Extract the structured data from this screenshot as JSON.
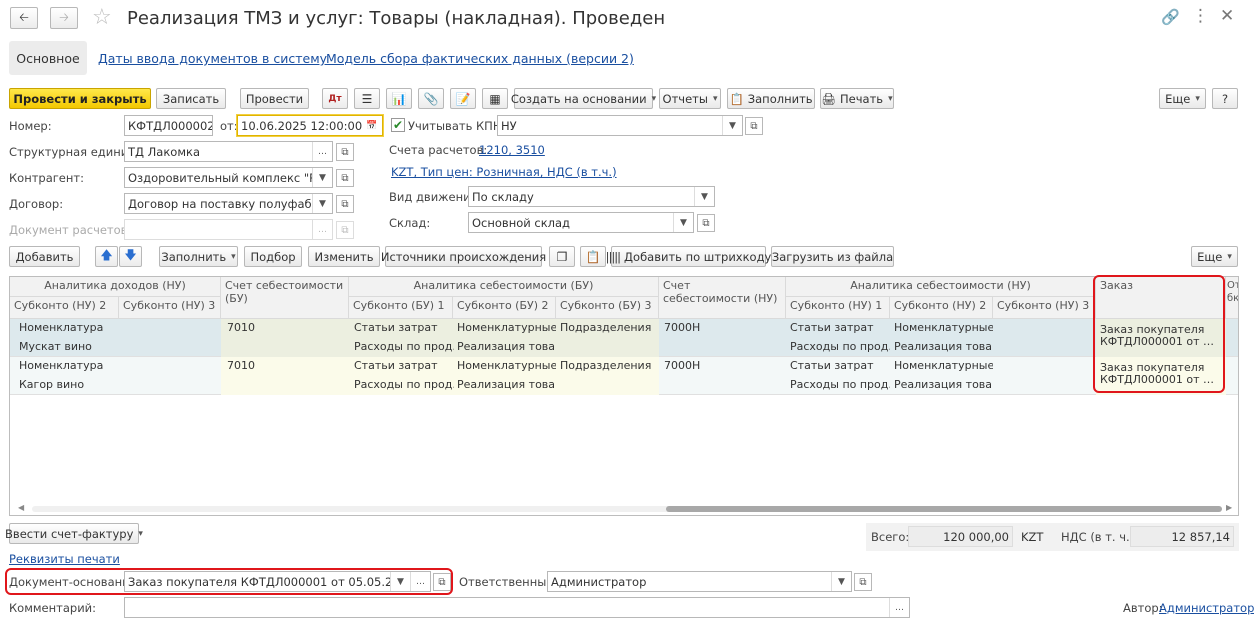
{
  "window": {
    "title": "Реализация ТМЗ и услуг: Товары (накладная). Проведен"
  },
  "tabs": [
    {
      "label": "Основное"
    },
    {
      "label": "Даты ввода документов в систему"
    },
    {
      "label": "Модель сбора фактических данных (версии 2)"
    }
  ],
  "toolbar": {
    "post_close": "Провести и закрыть",
    "save": "Записать",
    "post": "Провести",
    "create_based": "Создать на основании",
    "reports": "Отчеты",
    "fill": "Заполнить",
    "print": "Печать",
    "more": "Еще",
    "help": "?"
  },
  "header": {
    "number_label": "Номер:",
    "number": "КФТДЛ000002",
    "from_label": "от:",
    "date": "10.06.2025 12:00:00",
    "kpn_label": "Учитывать КПН",
    "kpn_value": "НУ",
    "unit_label": "Структурная единица:",
    "unit": "ТД Лакомка",
    "counterparty_label": "Контрагент:",
    "counterparty": "Оздоровительный комплекс \"Радуж",
    "contract_label": "Договор:",
    "contract": "Договор на поставку полуфабрикат",
    "settlement_doc_label": "Документ расчетов:",
    "accounts_label": "Счета расчетов:",
    "accounts": "1210, 3510",
    "price_type": "KZT, Тип цен: Розничная, НДС (в т.ч.)",
    "movement_label": "Вид движения:",
    "movement": "По складу",
    "warehouse_label": "Склад:",
    "warehouse": "Основной склад"
  },
  "table_toolbar": {
    "add": "Добавить",
    "fill": "Заполнить",
    "select": "Подбор",
    "change": "Изменить",
    "sources": "Источники происхождения",
    "barcode": "Добавить по штрихкоду",
    "load_file": "Загрузить из файла",
    "more": "Еще"
  },
  "table": {
    "group_headers": [
      "Аналитика доходов (НУ)",
      "Счет себестоимости (БУ)",
      "Аналитика себестоимости (БУ)",
      "Счет себестоимости (НУ)",
      "Аналитика себестоимости (НУ)",
      "Заказ",
      "От бк"
    ],
    "sub_headers": [
      "Субконто (НУ) 2",
      "Субконто (НУ) 3",
      "Субконто (БУ) 1",
      "Субконто (БУ) 2",
      "Субконто (БУ) 3",
      "Субконто (НУ) 1",
      "Субконто (НУ) 2",
      "Субконто (НУ) 3"
    ],
    "rows": [
      {
        "c1a": "Номенклатура",
        "c1b": "Мускат вино",
        "acc_bu": "7010",
        "b1a": "Статьи затрат",
        "b1b": "Расходы по прод…",
        "b2a": "Номенклатурные…",
        "b2b": "Реализация това…",
        "b3a": "Подразделения",
        "acc_nu": "7000Н",
        "n1a": "Статьи затрат",
        "n1b": "Расходы по прод…",
        "n2a": "Номенклатурные…",
        "n2b": "Реализация това…",
        "order_a": "Заказ покупателя",
        "order_b": "КФТДЛ000001 от …"
      },
      {
        "c1a": "Номенклатура",
        "c1b": "Кагор вино",
        "acc_bu": "7010",
        "b1a": "Статьи затрат",
        "b1b": "Расходы по прод…",
        "b2a": "Номенклатурные…",
        "b2b": "Реализация това…",
        "b3a": "Подразделения",
        "acc_nu": "7000Н",
        "n1a": "Статьи затрат",
        "n1b": "Расходы по прод…",
        "n2a": "Номенклатурные…",
        "n2b": "Реализация това…",
        "order_a": "Заказ покупателя",
        "order_b": "КФТДЛ000001 от …"
      }
    ]
  },
  "footer": {
    "invoice": "Ввести счет-фактуру",
    "print_details": "Реквизиты печати",
    "total_label": "Всего:",
    "total": "120 000,00",
    "currency": "KZT",
    "vat_label": "НДС (в т. ч.):",
    "vat": "12 857,14",
    "base_doc_label": "Документ-основание:",
    "base_doc": "Заказ покупателя КФТДЛ000001 от 05.05.2025 0:0",
    "responsible_label": "Ответственный:",
    "responsible": "Администратор",
    "comment_label": "Комментарий:",
    "author_label": "Автор:",
    "author": "Администратор"
  },
  "colors": {
    "accent": "#f3c800",
    "highlight": "#e0161b",
    "row_selected": "#dde9ed",
    "row_alt": "#f3f8f8"
  }
}
